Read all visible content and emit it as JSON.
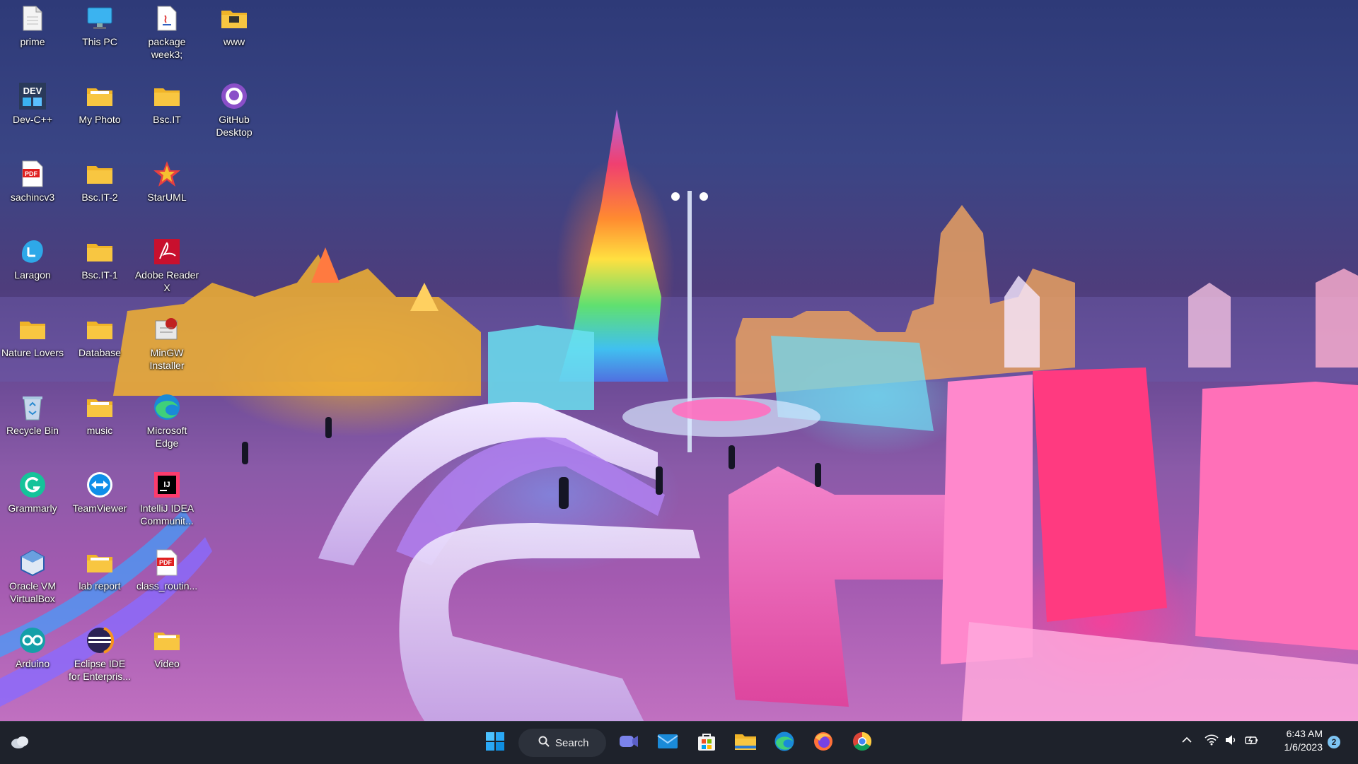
{
  "desktop": {
    "icons": [
      {
        "label": "prime",
        "icon": "document-icon"
      },
      {
        "label": "This PC",
        "icon": "monitor-icon"
      },
      {
        "label": "package week3;",
        "icon": "java-file-icon"
      },
      {
        "label": "www",
        "icon": "folder-icon"
      },
      {
        "label": "Dev-C++",
        "icon": "devcpp-icon"
      },
      {
        "label": "My Photo",
        "icon": "folder-icon"
      },
      {
        "label": "Bsc.IT",
        "icon": "folder-icon"
      },
      {
        "label": "GitHub Desktop",
        "icon": "github-icon"
      },
      {
        "label": "sachincv3",
        "icon": "pdf-icon"
      },
      {
        "label": "Bsc.IT-2",
        "icon": "folder-icon"
      },
      {
        "label": "StarUML",
        "icon": "staruml-icon"
      },
      {
        "label": "Laragon",
        "icon": "laragon-icon"
      },
      {
        "label": "Bsc.IT-1",
        "icon": "folder-icon"
      },
      {
        "label": "Adobe Reader X",
        "icon": "adobe-reader-icon"
      },
      {
        "label": "Nature Lovers",
        "icon": "folder-icon"
      },
      {
        "label": "Database",
        "icon": "folder-icon"
      },
      {
        "label": "MinGW Installer",
        "icon": "mingw-icon"
      },
      {
        "label": "Recycle Bin",
        "icon": "recycle-bin-icon"
      },
      {
        "label": "music",
        "icon": "folder-icon"
      },
      {
        "label": "Microsoft Edge",
        "icon": "edge-icon"
      },
      {
        "label": "Grammarly",
        "icon": "grammarly-icon"
      },
      {
        "label": "TeamViewer",
        "icon": "teamviewer-icon"
      },
      {
        "label": "IntelliJ IDEA Communit...",
        "icon": "intellij-icon"
      },
      {
        "label": "Oracle VM VirtualBox",
        "icon": "virtualbox-icon"
      },
      {
        "label": "lab report",
        "icon": "folder-icon"
      },
      {
        "label": "class_routin...",
        "icon": "pdf-icon"
      },
      {
        "label": "Arduino",
        "icon": "arduino-icon"
      },
      {
        "label": "Eclipse IDE for Enterpris...",
        "icon": "eclipse-icon"
      },
      {
        "label": "Video",
        "icon": "folder-icon"
      }
    ]
  },
  "taskbar": {
    "search_label": "Search",
    "pinned": [
      "start-icon",
      "teams-chat-icon",
      "mail-icon",
      "store-icon",
      "file-explorer-icon",
      "edge-icon",
      "firefox-icon",
      "chrome-icon"
    ],
    "tray": [
      "chevron-up-icon",
      "wifi-icon",
      "volume-icon",
      "battery-icon"
    ],
    "time": "6:43 AM",
    "date": "1/6/2023",
    "notification_count": "2"
  },
  "colors": {
    "taskbar": "#1e222b",
    "accent": "#0078d4",
    "folder": "#f8c641"
  }
}
